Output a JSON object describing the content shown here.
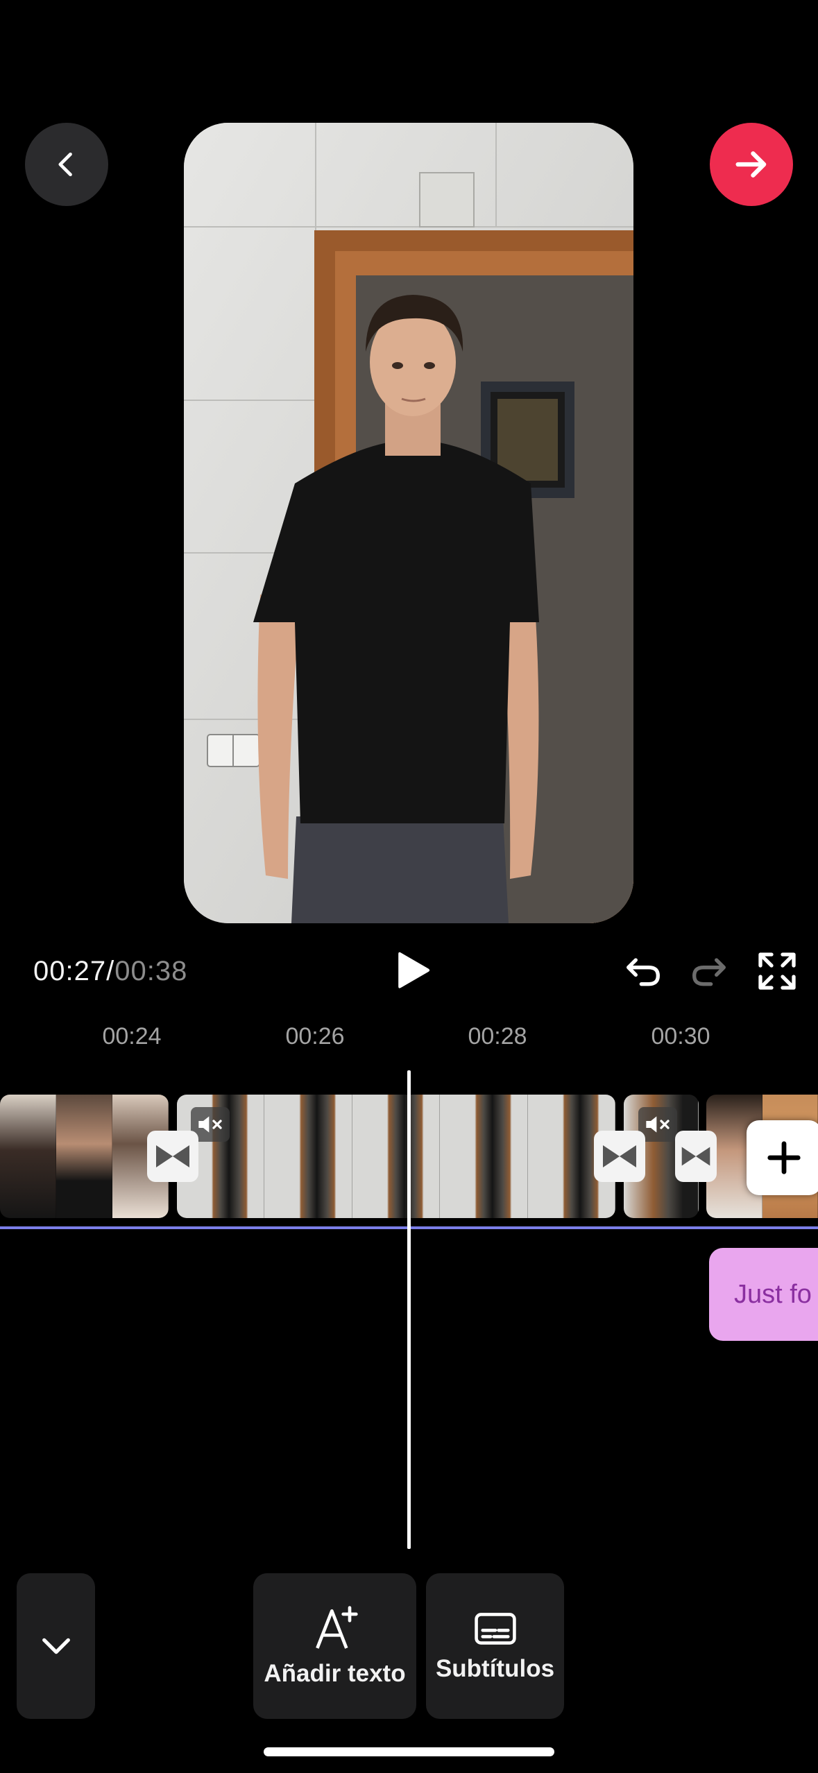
{
  "header": {
    "back_icon": "chevron-left-icon",
    "next_icon": "arrow-right-icon",
    "next_color": "#ee2c4f"
  },
  "player": {
    "current_time": "00:27",
    "separator": "/",
    "total_time": "00:38",
    "play_icon": "play-icon",
    "undo_icon": "undo-icon",
    "redo_icon": "redo-icon",
    "fullscreen_icon": "fullscreen-icon"
  },
  "ruler": {
    "ticks": [
      "00:24",
      "00:26",
      "00:28",
      "00:30"
    ]
  },
  "timeline": {
    "track_color": "#7b7ee8",
    "text_clip_label": "Just fo",
    "text_clip_color": "#e9a6ee"
  },
  "toolbar": {
    "collapse_icon": "chevron-down-icon",
    "add_text_label": "Añadir texto",
    "subtitles_label": "Subtítulos"
  }
}
